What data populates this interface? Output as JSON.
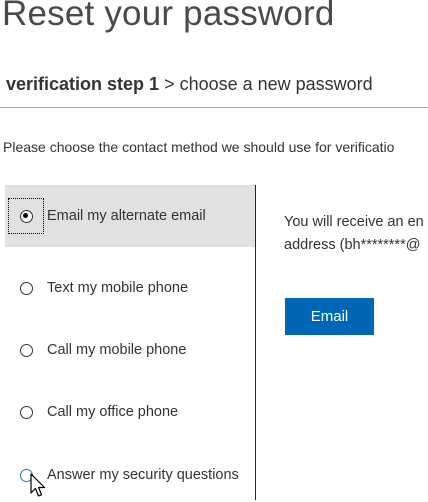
{
  "header": {
    "title": "Reset your password"
  },
  "breadcrumb": {
    "current_step": "verification step 1",
    "separator": " > ",
    "next_step": "choose a new password"
  },
  "instructions": "Please choose the contact method we should use for verificatio",
  "contact_methods": [
    {
      "label": "Email my alternate email",
      "selected": true
    },
    {
      "label": "Text my mobile phone",
      "selected": false
    },
    {
      "label": "Call my mobile phone",
      "selected": false
    },
    {
      "label": "Call my office phone",
      "selected": false
    },
    {
      "label": "Answer my security questions",
      "selected": false
    }
  ],
  "detail": {
    "line1": "You will receive an en",
    "line2": "address (bh********@",
    "button_label": "Email"
  },
  "colors": {
    "accent": "#0067b8",
    "selected_background": "#e1e1e1"
  }
}
